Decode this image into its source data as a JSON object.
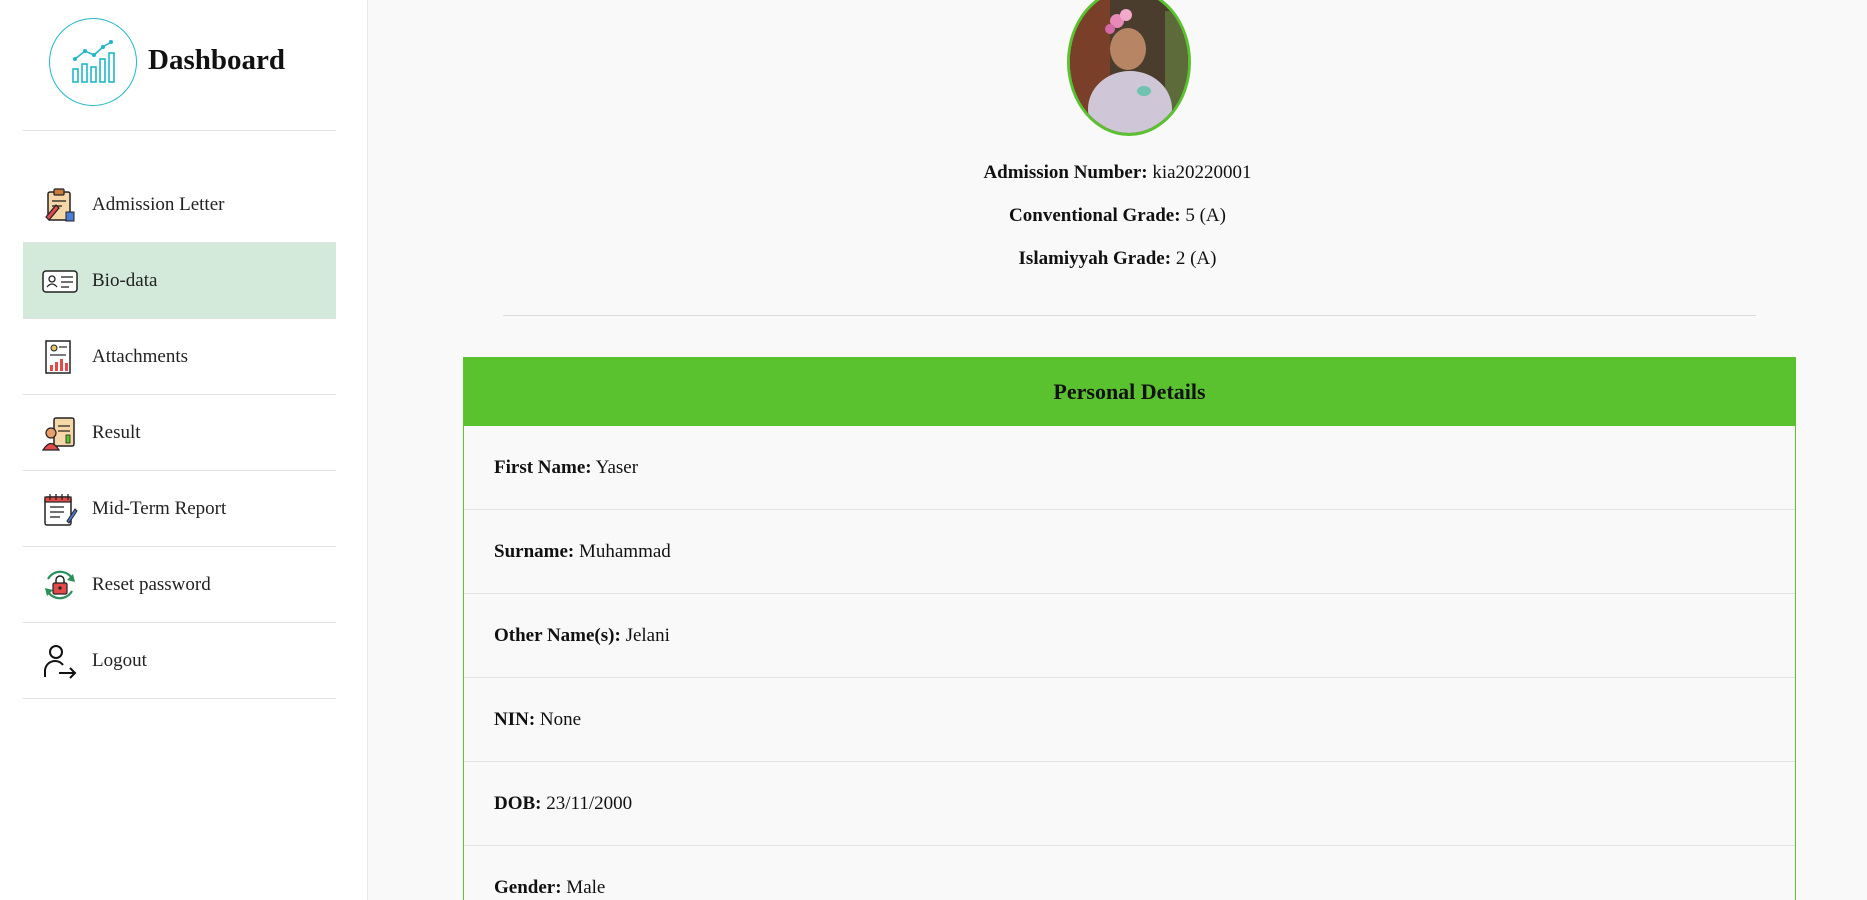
{
  "brand": {
    "title": "Dashboard",
    "logo_icon": "chart-icon"
  },
  "nav": {
    "items": [
      {
        "label": "Admission Letter",
        "icon": "clipboard-pen-icon"
      },
      {
        "label": "Bio-data",
        "icon": "id-card-icon",
        "active": true
      },
      {
        "label": "Attachments",
        "icon": "document-chart-icon"
      },
      {
        "label": "Result",
        "icon": "result-clipboard-icon"
      },
      {
        "label": "Mid-Term Report",
        "icon": "notepad-icon"
      },
      {
        "label": "Reset password",
        "icon": "lock-reset-icon"
      },
      {
        "label": "Logout",
        "icon": "user-logout-icon"
      }
    ]
  },
  "profile": {
    "admission_label": "Admission Number:",
    "admission_value": "kia20220001",
    "conventional_label": "Conventional Grade:",
    "conventional_value": "5 (A)",
    "islamiyyah_label": "Islamiyyah Grade:",
    "islamiyyah_value": "2 (A)"
  },
  "personal": {
    "heading": "Personal Details",
    "fields": [
      {
        "label": "First Name:",
        "value": "Yaser"
      },
      {
        "label": "Surname:",
        "value": "Muhammad"
      },
      {
        "label": "Other Name(s):",
        "value": "Jelani"
      },
      {
        "label": "NIN:",
        "value": "None"
      },
      {
        "label": "DOB:",
        "value": "23/11/2000"
      },
      {
        "label": "Gender:",
        "value": "Male"
      }
    ]
  },
  "colors": {
    "accent_green": "#5bc22f",
    "active_nav": "#d3e9da",
    "logo_teal": "#1fb8c9"
  }
}
